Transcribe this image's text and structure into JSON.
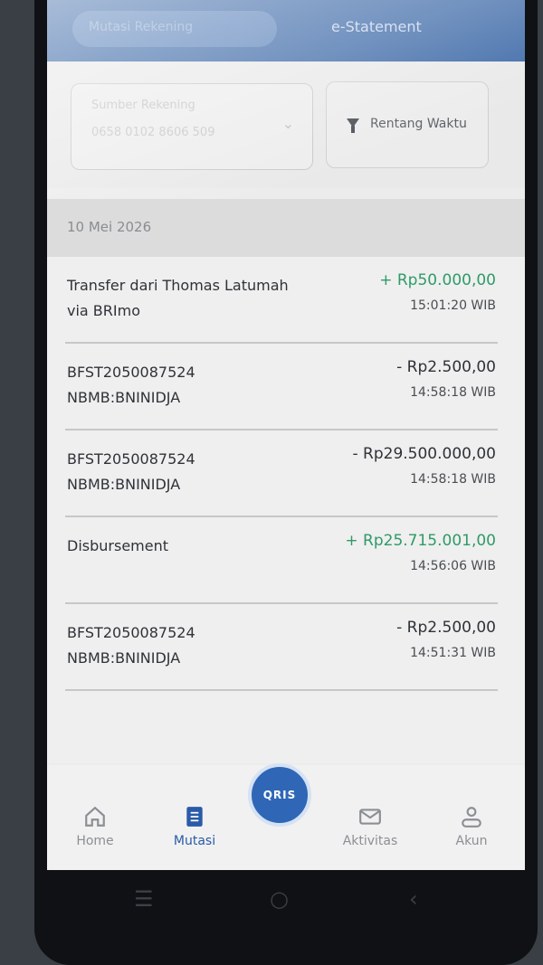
{
  "header": {
    "tab_mutasi": "Mutasi Rekening",
    "tab_estatement": "e-Statement"
  },
  "filters": {
    "account_label": "Sumber Rekening",
    "account_number": "0658 0102 8606 509",
    "range_label": "Rentang Waktu"
  },
  "date_group": "10 Mei 2026",
  "transactions": [
    {
      "desc1": "Transfer dari Thomas Latumah",
      "desc2": "via BRImo",
      "amount": "+ Rp50.000,00",
      "time": "15:01:20 WIB",
      "type": "credit"
    },
    {
      "desc1": "BFST2050087524",
      "desc2": "NBMB:BNINIDJA",
      "amount": "- Rp2.500,00",
      "time": "14:58:18 WIB",
      "type": "debit"
    },
    {
      "desc1": "BFST2050087524",
      "desc2": "NBMB:BNINIDJA",
      "amount": "- Rp29.500.000,00",
      "time": "14:58:18 WIB",
      "type": "debit"
    },
    {
      "desc1": "Disbursement",
      "desc2": "",
      "amount": "+ Rp25.715.001,00",
      "time": "14:56:06 WIB",
      "type": "credit"
    },
    {
      "desc1": "BFST2050087524",
      "desc2": "NBMB:BNINIDJA",
      "amount": "- Rp2.500,00",
      "time": "14:51:31 WIB",
      "type": "debit"
    }
  ],
  "nav": {
    "home": "Home",
    "mutasi": "Mutasi",
    "qris": "QRIS",
    "aktivitas": "Aktivitas",
    "akun": "Akun"
  },
  "colors": {
    "brand_blue": "#2f67b6",
    "credit_green": "#2f9a69"
  }
}
